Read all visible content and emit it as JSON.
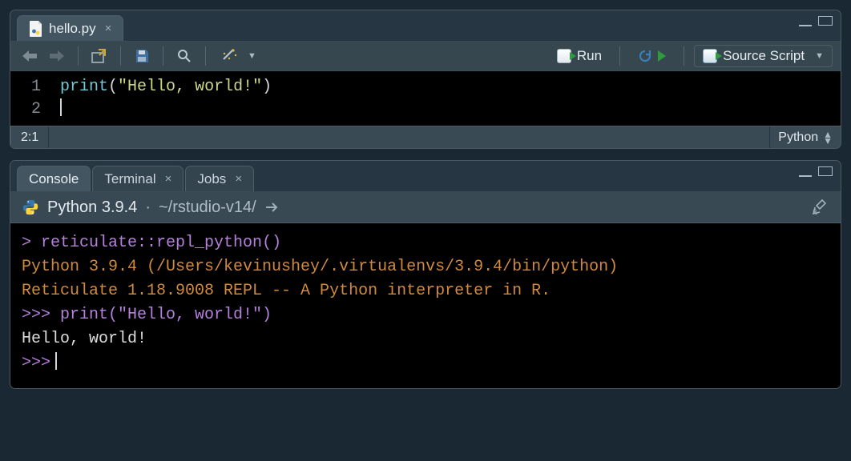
{
  "editor": {
    "tab": {
      "filename": "hello.py"
    },
    "toolbar": {
      "run_label": "Run",
      "source_label": "Source Script"
    },
    "code": {
      "fn": "print",
      "open": "(",
      "str": "\"Hello, world!\"",
      "close": ")"
    },
    "gutter": [
      "1",
      "2"
    ],
    "status": {
      "cursor_pos": "2:1",
      "language": "Python"
    }
  },
  "console": {
    "tabs": {
      "console": "Console",
      "terminal": "Terminal",
      "jobs": "Jobs"
    },
    "header": {
      "version": "Python 3.9.4",
      "separator": "·",
      "path": "~/rstudio-v14/"
    },
    "lines": {
      "l1_prompt": ">",
      "l1_code": " reticulate::repl_python()",
      "l2": "Python 3.9.4 (/Users/kevinushey/.virtualenvs/3.9.4/bin/python)",
      "l3": "Reticulate 1.18.9008 REPL -- A Python interpreter in R.",
      "l4_prompt": ">>>",
      "l4_code": " print(\"Hello, world!\")",
      "l5": "Hello, world!",
      "l6_prompt": ">>>"
    }
  }
}
